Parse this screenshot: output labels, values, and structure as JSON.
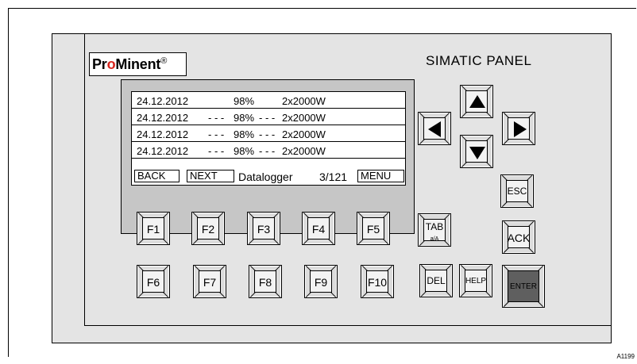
{
  "brand": {
    "pro": "Pr",
    "o": "o",
    "minent": "Minent",
    "reg": "®"
  },
  "panel_title": "SIMATIC PANEL",
  "doc_id": "A1199",
  "display": {
    "rows": [
      {
        "date": "24.12.2012",
        "sep1": "",
        "pct": "98%",
        "sep2": "",
        "value": "2x2000W"
      },
      {
        "date": "24.12.2012",
        "sep1": "- - -",
        "pct": "98%",
        "sep2": "- - -",
        "value": "2x2000W"
      },
      {
        "date": "24.12.2012",
        "sep1": "- - -",
        "pct": "98%",
        "sep2": "- - -",
        "value": "2x2000W"
      },
      {
        "date": "24.12.2012",
        "sep1": "- - -",
        "pct": "98%",
        "sep2": "- - -",
        "value": "2x2000W"
      }
    ],
    "softkeys": {
      "back": "BACK",
      "next": "NEXT",
      "menu": "MENU"
    },
    "screen_name": "Datalogger",
    "page": "3/121"
  },
  "keys": {
    "f1": "F1",
    "f2": "F2",
    "f3": "F3",
    "f4": "F4",
    "f5": "F5",
    "f6": "F6",
    "f7": "F7",
    "f8": "F8",
    "f9": "F9",
    "f10": "F10",
    "tab": "TAB",
    "tab_sub": "a/A",
    "del": "DEL",
    "help": "HELP",
    "esc": "ESC",
    "ack": "ACK",
    "enter": "ENTER"
  },
  "colors": {
    "brand_accent": "#d9251d",
    "enter_key": "#5f5f5f",
    "panel": "#e4e4e4",
    "bezel": "#c6c6c6"
  }
}
